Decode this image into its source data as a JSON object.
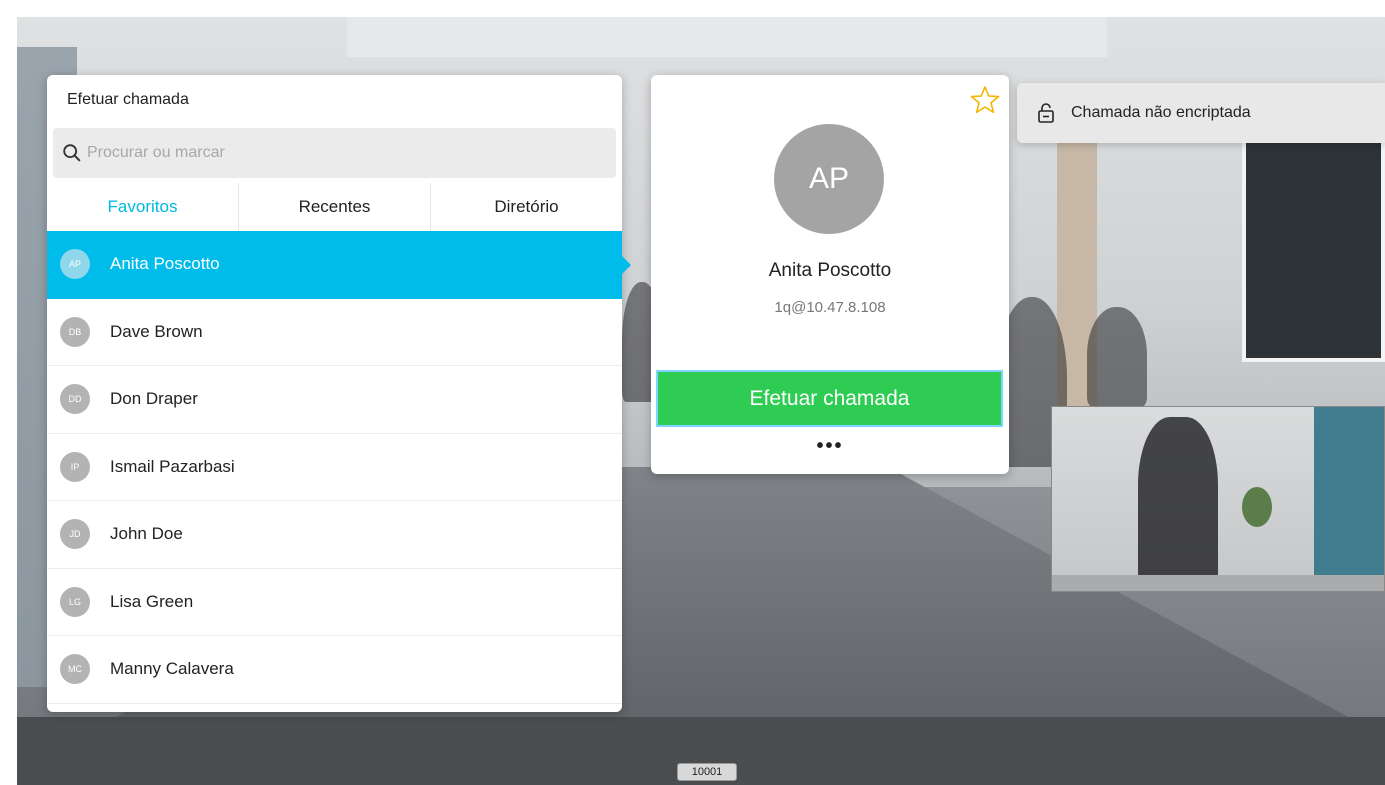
{
  "call_panel": {
    "title": "Efetuar chamada",
    "search_placeholder": "Procurar ou marcar",
    "tabs": [
      {
        "label": "Favoritos",
        "active": true
      },
      {
        "label": "Recentes",
        "active": false
      },
      {
        "label": "Diretório",
        "active": false
      }
    ],
    "contacts": [
      {
        "initials": "AP",
        "name": "Anita Poscotto",
        "selected": true
      },
      {
        "initials": "DB",
        "name": "Dave Brown",
        "selected": false
      },
      {
        "initials": "DD",
        "name": "Don Draper",
        "selected": false
      },
      {
        "initials": "IP",
        "name": "Ismail Pazarbasi",
        "selected": false
      },
      {
        "initials": "JD",
        "name": "John Doe",
        "selected": false
      },
      {
        "initials": "LG",
        "name": "Lisa Green",
        "selected": false
      },
      {
        "initials": "MC",
        "name": "Manny Calavera",
        "selected": false
      }
    ]
  },
  "detail_card": {
    "initials": "AP",
    "name": "Anita Poscotto",
    "address": "1q@10.47.8.108",
    "call_label": "Efetuar chamada",
    "more_label": "•••",
    "favorite_icon": "star-outline-icon"
  },
  "encryption": {
    "text": "Chamada não encriptada",
    "icon": "lock-open-icon"
  },
  "status_bar": {
    "number": "10001"
  },
  "colors": {
    "accent": "#00bceb",
    "call_green": "#2fcc54",
    "star": "#f4b400"
  }
}
